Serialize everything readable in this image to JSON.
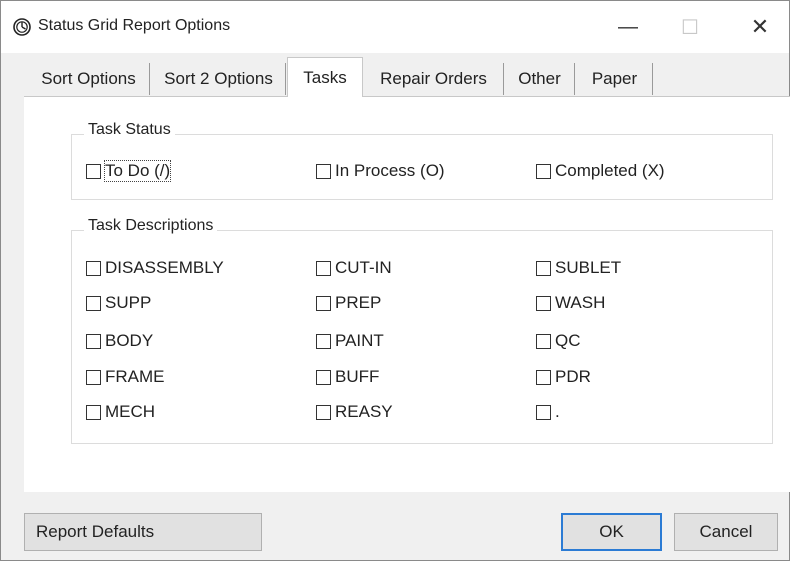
{
  "window": {
    "title": "Status Grid Report Options",
    "icon": "clock-icon",
    "minimize_glyph": "—",
    "maximize_glyph": "☐",
    "close_glyph": "✕"
  },
  "tabs": [
    {
      "label": "Sort Options",
      "active": false
    },
    {
      "label": "Sort 2 Options",
      "active": false
    },
    {
      "label": "Tasks",
      "active": true
    },
    {
      "label": "Repair Orders",
      "active": false
    },
    {
      "label": "Other",
      "active": false
    },
    {
      "label": "Paper",
      "active": false
    }
  ],
  "task_status": {
    "legend": "Task Status",
    "items": [
      {
        "label": "To Do (/)",
        "checked": false,
        "focused": true
      },
      {
        "label": "In Process (O)",
        "checked": false
      },
      {
        "label": "Completed (X)",
        "checked": false
      }
    ]
  },
  "task_descriptions": {
    "legend": "Task Descriptions",
    "items": [
      {
        "label": "DISASSEMBLY",
        "checked": false
      },
      {
        "label": "CUT-IN",
        "checked": false
      },
      {
        "label": "SUBLET",
        "checked": false
      },
      {
        "label": "SUPP",
        "checked": false
      },
      {
        "label": "PREP",
        "checked": false
      },
      {
        "label": "WASH",
        "checked": false
      },
      {
        "label": "BODY",
        "checked": false
      },
      {
        "label": "PAINT",
        "checked": false
      },
      {
        "label": "QC",
        "checked": false
      },
      {
        "label": "FRAME",
        "checked": false
      },
      {
        "label": "BUFF",
        "checked": false
      },
      {
        "label": "PDR",
        "checked": false
      },
      {
        "label": "MECH",
        "checked": false
      },
      {
        "label": "REASY",
        "checked": false
      },
      {
        "label": ".",
        "checked": false
      }
    ]
  },
  "buttons": {
    "defaults": "Report Defaults",
    "ok": "OK",
    "cancel": "Cancel"
  }
}
